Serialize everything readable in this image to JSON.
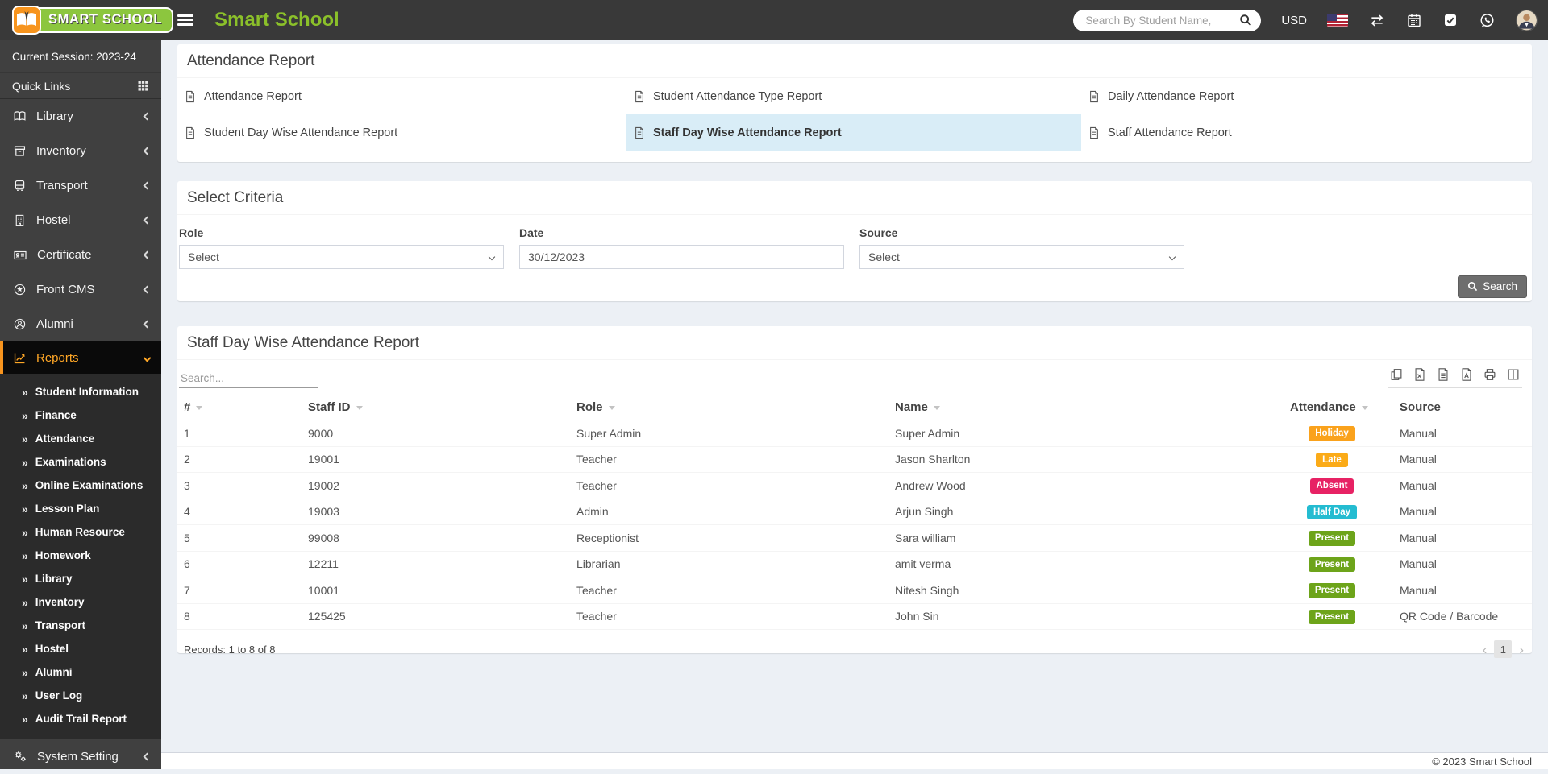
{
  "navbar": {
    "logo_text": "SMART SCHOOL",
    "app_title": "Smart School",
    "search_placeholder": "Search By Student Name,",
    "currency_label": "USD"
  },
  "sidebar": {
    "session_label": "Current Session: 2023-24",
    "quick_links_label": "Quick Links",
    "items": [
      {
        "label": "Library",
        "icon": "book-icon"
      },
      {
        "label": "Inventory",
        "icon": "inventory-icon"
      },
      {
        "label": "Transport",
        "icon": "bus-icon"
      },
      {
        "label": "Hostel",
        "icon": "building-icon"
      },
      {
        "label": "Certificate",
        "icon": "certificate-icon"
      },
      {
        "label": "Front CMS",
        "icon": "front-cms-icon"
      },
      {
        "label": "Alumni",
        "icon": "alumni-icon"
      }
    ],
    "reports_label": "Reports",
    "submenu": [
      "Student Information",
      "Finance",
      "Attendance",
      "Examinations",
      "Online Examinations",
      "Lesson Plan",
      "Human Resource",
      "Homework",
      "Library",
      "Inventory",
      "Transport",
      "Hostel",
      "Alumni",
      "User Log",
      "Audit Trail Report"
    ],
    "system_setting_label": "System Setting"
  },
  "report_nav": {
    "title": "Attendance Report",
    "links": [
      {
        "label": "Attendance Report",
        "active": false
      },
      {
        "label": "Student Attendance Type Report",
        "active": false
      },
      {
        "label": "Daily Attendance Report",
        "active": false
      },
      {
        "label": "Student Day Wise Attendance Report",
        "active": false
      },
      {
        "label": "Staff Day Wise Attendance Report",
        "active": true
      },
      {
        "label": "Staff Attendance Report",
        "active": false
      }
    ]
  },
  "criteria": {
    "title": "Select Criteria",
    "fields": [
      {
        "label": "Role",
        "type": "select",
        "value": "Select"
      },
      {
        "label": "Date",
        "type": "text",
        "value": "30/12/2023"
      },
      {
        "label": "Source",
        "type": "select",
        "value": "Select"
      }
    ],
    "search_button_label": "Search"
  },
  "report_table": {
    "title": "Staff Day Wise Attendance Report",
    "search_placeholder": "Search...",
    "columns": [
      "#",
      "Staff ID",
      "Role",
      "Name",
      "Attendance",
      "Source"
    ],
    "rows": [
      {
        "num": "1",
        "staff_id": "9000",
        "role": "Super Admin",
        "name": "Super Admin",
        "attendance": "Holiday",
        "source": "Manual"
      },
      {
        "num": "2",
        "staff_id": "19001",
        "role": "Teacher",
        "name": "Jason Sharlton",
        "attendance": "Late",
        "source": "Manual"
      },
      {
        "num": "3",
        "staff_id": "19002",
        "role": "Teacher",
        "name": "Andrew Wood",
        "attendance": "Absent",
        "source": "Manual"
      },
      {
        "num": "4",
        "staff_id": "19003",
        "role": "Admin",
        "name": "Arjun Singh",
        "attendance": "Half Day",
        "source": "Manual"
      },
      {
        "num": "5",
        "staff_id": "99008",
        "role": "Receptionist",
        "name": "Sara william",
        "attendance": "Present",
        "source": "Manual"
      },
      {
        "num": "6",
        "staff_id": "12211",
        "role": "Librarian",
        "name": "amit verma",
        "attendance": "Present",
        "source": "Manual"
      },
      {
        "num": "7",
        "staff_id": "10001",
        "role": "Teacher",
        "name": "Nitesh Singh",
        "attendance": "Present",
        "source": "Manual"
      },
      {
        "num": "8",
        "staff_id": "125425",
        "role": "Teacher",
        "name": "John Sin",
        "attendance": "Present",
        "source": "QR Code / Barcode"
      }
    ],
    "records_text": "Records: 1 to 8 of 8",
    "pagination": {
      "prev": "‹",
      "current": "1",
      "next": "›"
    }
  },
  "footer": {
    "copyright": "© 2023 Smart School"
  },
  "colors": {
    "brand_green": "#8cc63e",
    "title_green": "#8bc02a",
    "accent_orange": "#f7941e",
    "reports_text": "#ffa726",
    "active_link_bg": "#d9edf7",
    "badge_colors": {
      "Holiday": "#faa21c",
      "Late": "#fbab18",
      "Absent": "#e72264",
      "Half Day": "#24bcd1",
      "Present": "#6da41a"
    }
  }
}
